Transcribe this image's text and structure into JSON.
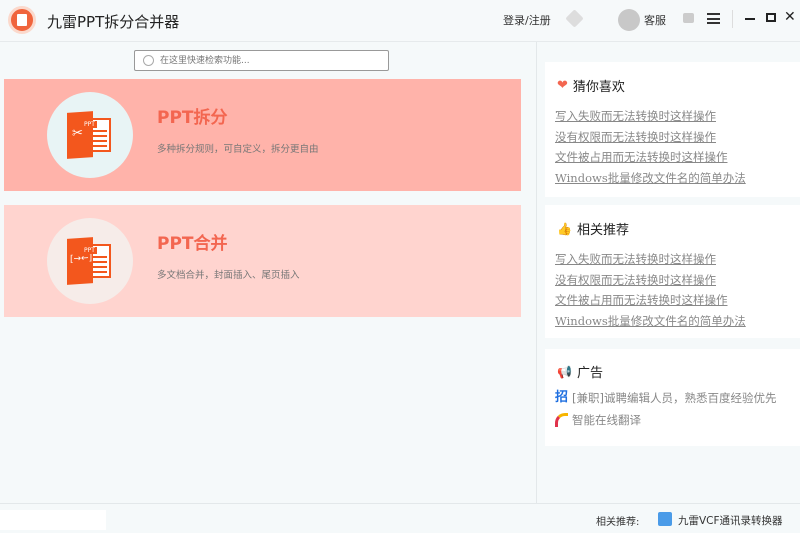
{
  "app": {
    "title": "九雷PPT拆分合并器",
    "login": "登录/注册",
    "service": "客服"
  },
  "search": {
    "placeholder": "在这里快速检索功能..."
  },
  "cards": [
    {
      "title": "PPT拆分",
      "desc": "多种拆分规则，可自定义，拆分更自由",
      "tag": "PPT",
      "bg": "#ffb3aa"
    },
    {
      "title": "PPT合并",
      "desc": "多文档合并，封面插入、尾页插入",
      "tag": "PPT",
      "bg": "#ffd4cf"
    }
  ],
  "guess": {
    "title": "猜你喜欢",
    "links": [
      "写入失败而无法转换时这样操作",
      "没有权限而无法转换时这样操作",
      "文件被占用而无法转换时这样操作",
      "Windows批量修改文件名的简单办法"
    ]
  },
  "related": {
    "title": "相关推荐",
    "links": [
      "写入失败而无法转换时这样操作",
      "没有权限而无法转换时这样操作",
      "文件被占用而无法转换时这样操作",
      "Windows批量修改文件名的简单办法"
    ]
  },
  "ads": {
    "title": "广告",
    "items": [
      {
        "icon": "招",
        "text": "[兼职]诚聘编辑人员，熟悉百度经验优先"
      },
      {
        "text": "智能在线翻译"
      }
    ]
  },
  "footer": {
    "label": "相关推荐:",
    "app": "九雷VCF通讯录转换器"
  }
}
